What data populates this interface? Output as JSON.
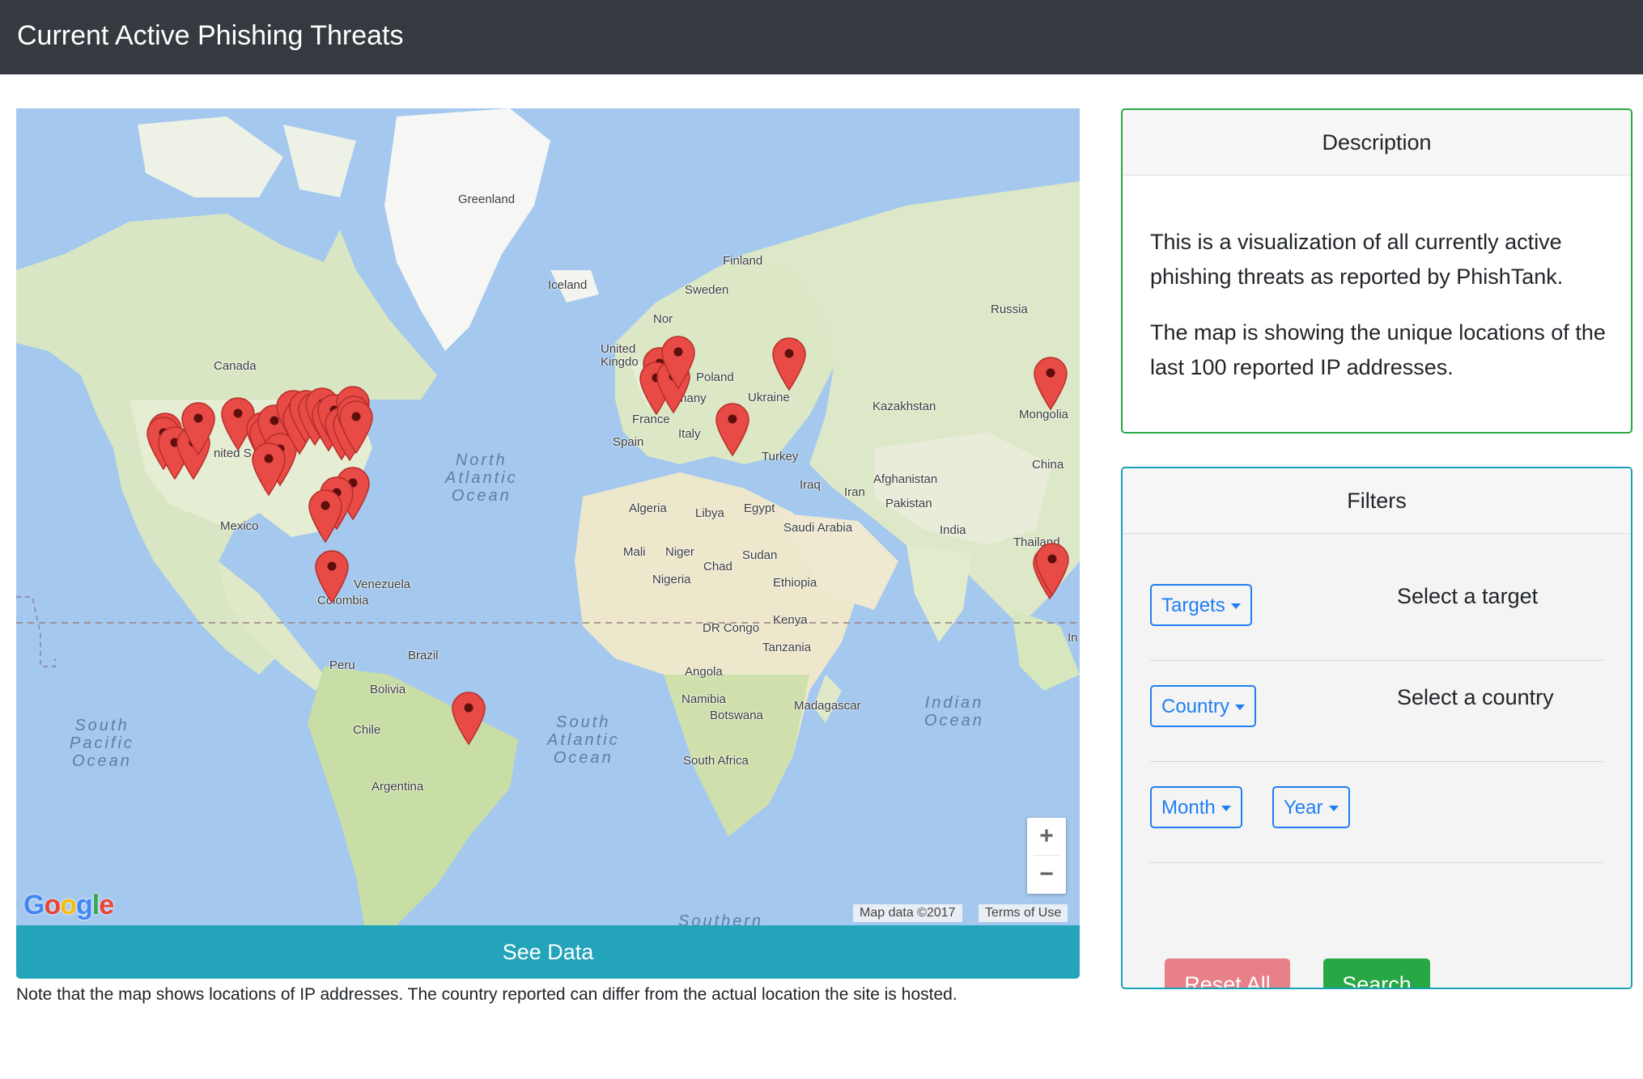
{
  "header": {
    "title": "Current Active Phishing Threats"
  },
  "map": {
    "labels": {
      "greenland": "Greenland",
      "iceland": "Iceland",
      "finland": "Finland",
      "sweden": "Sweden",
      "norway": "Nor",
      "russia": "Russia",
      "uk": "United\nKingdo",
      "canada": "Canada",
      "usa": "nited S",
      "poland": "Poland",
      "germany": "Germany",
      "ukraine": "Ukraine",
      "kazakhstan": "Kazakhstan",
      "mongolia": "Mongolia",
      "france": "France",
      "italy": "Italy",
      "spain": "Spain",
      "turkey": "Turkey",
      "china": "China",
      "afghanistan": "Afghanistan",
      "iraq": "Iraq",
      "iran": "Iran",
      "pakistan": "Pakistan",
      "mexico": "Mexico",
      "algeria": "Algeria",
      "libya": "Libya",
      "egypt": "Egypt",
      "saudi": "Saudi Arabia",
      "india": "India",
      "thailand": "Thailand",
      "mali": "Mali",
      "niger": "Niger",
      "chad": "Chad",
      "sudan": "Sudan",
      "nigeria": "Nigeria",
      "ethiopia": "Ethiopia",
      "venezuela": "Venezuela",
      "colombia": "Colombia",
      "kenya": "Kenya",
      "drcongo": "DR Congo",
      "tanzania": "Tanzania",
      "indonesia": "In",
      "peru": "Peru",
      "brazil": "Brazil",
      "bolivia": "Bolivia",
      "angola": "Angola",
      "namibia": "Namibia",
      "botswana": "Botswana",
      "madagascar": "Madagascar",
      "chile": "Chile",
      "southafrica": "South Africa",
      "argentina": "Argentina"
    },
    "oceans": {
      "north_atlantic": "North\nAtlantic\nOcean",
      "south_atlantic": "South\nAtlantic\nOcean",
      "south_pacific": "South\nPacific\nOcean",
      "indian": "Indian\nOcean",
      "southern": "Southern"
    },
    "zoom_in": "+",
    "zoom_out": "−",
    "google_logo": "Google",
    "map_data": "Map data ©2017",
    "terms": "Terms of Use",
    "marker_count_shown": 37,
    "marker_color": "#e84a45",
    "marker_icon": "map-pin-icon"
  },
  "see_data_label": "See Data",
  "note": "Note that the map shows locations of IP addresses. The country reported can differ from the actual location the site is hosted.",
  "description": {
    "title": "Description",
    "p1": "This is a visualization of all currently active phishing threats as reported by PhishTank.",
    "p2": "The map is showing the unique locations of the last 100 reported IP addresses."
  },
  "filters": {
    "title": "Filters",
    "targets_label": "Targets",
    "targets_hint": "Select a target",
    "country_label": "Country",
    "country_hint": "Select a country",
    "month_label": "Month",
    "year_label": "Year",
    "reset_label": "Reset All",
    "search_label": "Search"
  },
  "colors": {
    "navbar": "#343a40",
    "primary": "#1f7ff2",
    "success": "#28a745",
    "info": "#24a4ba",
    "danger_light": "#e78088",
    "desc_border": "#28a745",
    "filters_border": "#17a2b8"
  }
}
